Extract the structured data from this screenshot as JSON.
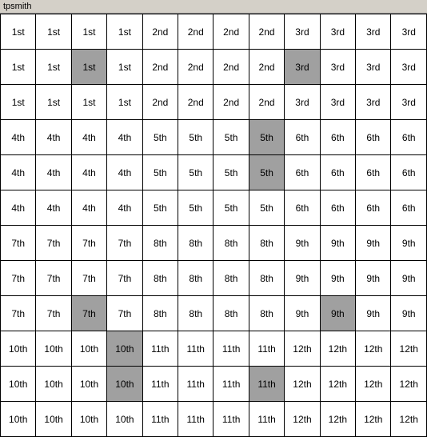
{
  "title": "tpsmith",
  "grid": {
    "rows": [
      [
        {
          "text": "1st",
          "style": "normal"
        },
        {
          "text": "1st",
          "style": "normal"
        },
        {
          "text": "1st",
          "style": "normal"
        },
        {
          "text": "1st",
          "style": "normal"
        },
        {
          "text": "2nd",
          "style": "normal"
        },
        {
          "text": "2nd",
          "style": "normal"
        },
        {
          "text": "2nd",
          "style": "normal"
        },
        {
          "text": "2nd",
          "style": "normal"
        },
        {
          "text": "3rd",
          "style": "normal"
        },
        {
          "text": "3rd",
          "style": "normal"
        },
        {
          "text": "3rd",
          "style": "normal"
        },
        {
          "text": "3rd",
          "style": "normal"
        }
      ],
      [
        {
          "text": "1st",
          "style": "normal"
        },
        {
          "text": "1st",
          "style": "normal"
        },
        {
          "text": "1st",
          "style": "highlight"
        },
        {
          "text": "1st",
          "style": "normal"
        },
        {
          "text": "2nd",
          "style": "normal"
        },
        {
          "text": "2nd",
          "style": "normal"
        },
        {
          "text": "2nd",
          "style": "normal"
        },
        {
          "text": "2nd",
          "style": "normal"
        },
        {
          "text": "3rd",
          "style": "highlight"
        },
        {
          "text": "3rd",
          "style": "normal"
        },
        {
          "text": "3rd",
          "style": "normal"
        },
        {
          "text": "3rd",
          "style": "normal"
        }
      ],
      [
        {
          "text": "1st",
          "style": "normal"
        },
        {
          "text": "1st",
          "style": "normal"
        },
        {
          "text": "1st",
          "style": "normal"
        },
        {
          "text": "1st",
          "style": "normal"
        },
        {
          "text": "2nd",
          "style": "normal"
        },
        {
          "text": "2nd",
          "style": "normal"
        },
        {
          "text": "2nd",
          "style": "normal"
        },
        {
          "text": "2nd",
          "style": "normal"
        },
        {
          "text": "3rd",
          "style": "normal"
        },
        {
          "text": "3rd",
          "style": "normal"
        },
        {
          "text": "3rd",
          "style": "normal"
        },
        {
          "text": "3rd",
          "style": "normal"
        }
      ],
      [
        {
          "text": "4th",
          "style": "normal"
        },
        {
          "text": "4th",
          "style": "normal"
        },
        {
          "text": "4th",
          "style": "normal"
        },
        {
          "text": "4th",
          "style": "normal"
        },
        {
          "text": "5th",
          "style": "normal"
        },
        {
          "text": "5th",
          "style": "normal"
        },
        {
          "text": "5th",
          "style": "normal"
        },
        {
          "text": "5th",
          "style": "highlight"
        },
        {
          "text": "6th",
          "style": "normal"
        },
        {
          "text": "6th",
          "style": "normal"
        },
        {
          "text": "6th",
          "style": "normal"
        },
        {
          "text": "6th",
          "style": "normal"
        }
      ],
      [
        {
          "text": "4th",
          "style": "normal"
        },
        {
          "text": "4th",
          "style": "normal"
        },
        {
          "text": "4th",
          "style": "normal"
        },
        {
          "text": "4th",
          "style": "normal"
        },
        {
          "text": "5th",
          "style": "normal"
        },
        {
          "text": "5th",
          "style": "normal"
        },
        {
          "text": "5th",
          "style": "normal"
        },
        {
          "text": "5th",
          "style": "highlight"
        },
        {
          "text": "6th",
          "style": "normal"
        },
        {
          "text": "6th",
          "style": "normal"
        },
        {
          "text": "6th",
          "style": "normal"
        },
        {
          "text": "6th",
          "style": "normal"
        }
      ],
      [
        {
          "text": "4th",
          "style": "normal"
        },
        {
          "text": "4th",
          "style": "normal"
        },
        {
          "text": "4th",
          "style": "normal"
        },
        {
          "text": "4th",
          "style": "normal"
        },
        {
          "text": "5th",
          "style": "normal"
        },
        {
          "text": "5th",
          "style": "normal"
        },
        {
          "text": "5th",
          "style": "normal"
        },
        {
          "text": "5th",
          "style": "normal"
        },
        {
          "text": "6th",
          "style": "normal"
        },
        {
          "text": "6th",
          "style": "normal"
        },
        {
          "text": "6th",
          "style": "normal"
        },
        {
          "text": "6th",
          "style": "normal"
        }
      ],
      [
        {
          "text": "7th",
          "style": "normal"
        },
        {
          "text": "7th",
          "style": "normal"
        },
        {
          "text": "7th",
          "style": "normal"
        },
        {
          "text": "7th",
          "style": "normal"
        },
        {
          "text": "8th",
          "style": "normal"
        },
        {
          "text": "8th",
          "style": "normal"
        },
        {
          "text": "8th",
          "style": "normal"
        },
        {
          "text": "8th",
          "style": "normal"
        },
        {
          "text": "9th",
          "style": "normal"
        },
        {
          "text": "9th",
          "style": "normal"
        },
        {
          "text": "9th",
          "style": "normal"
        },
        {
          "text": "9th",
          "style": "normal"
        }
      ],
      [
        {
          "text": "7th",
          "style": "normal"
        },
        {
          "text": "7th",
          "style": "normal"
        },
        {
          "text": "7th",
          "style": "normal"
        },
        {
          "text": "7th",
          "style": "normal"
        },
        {
          "text": "8th",
          "style": "normal"
        },
        {
          "text": "8th",
          "style": "normal"
        },
        {
          "text": "8th",
          "style": "normal"
        },
        {
          "text": "8th",
          "style": "normal"
        },
        {
          "text": "9th",
          "style": "normal"
        },
        {
          "text": "9th",
          "style": "normal"
        },
        {
          "text": "9th",
          "style": "normal"
        },
        {
          "text": "9th",
          "style": "normal"
        }
      ],
      [
        {
          "text": "7th",
          "style": "normal"
        },
        {
          "text": "7th",
          "style": "normal"
        },
        {
          "text": "7th",
          "style": "highlight"
        },
        {
          "text": "7th",
          "style": "normal"
        },
        {
          "text": "8th",
          "style": "normal"
        },
        {
          "text": "8th",
          "style": "normal"
        },
        {
          "text": "8th",
          "style": "normal"
        },
        {
          "text": "8th",
          "style": "normal"
        },
        {
          "text": "9th",
          "style": "normal"
        },
        {
          "text": "9th",
          "style": "highlight"
        },
        {
          "text": "9th",
          "style": "normal"
        },
        {
          "text": "9th",
          "style": "normal"
        }
      ],
      [
        {
          "text": "10th",
          "style": "normal"
        },
        {
          "text": "10th",
          "style": "normal"
        },
        {
          "text": "10th",
          "style": "normal"
        },
        {
          "text": "10th",
          "style": "highlight"
        },
        {
          "text": "11th",
          "style": "normal"
        },
        {
          "text": "11th",
          "style": "normal"
        },
        {
          "text": "11th",
          "style": "normal"
        },
        {
          "text": "11th",
          "style": "normal"
        },
        {
          "text": "12th",
          "style": "normal"
        },
        {
          "text": "12th",
          "style": "normal"
        },
        {
          "text": "12th",
          "style": "normal"
        },
        {
          "text": "12th",
          "style": "normal"
        }
      ],
      [
        {
          "text": "10th",
          "style": "normal"
        },
        {
          "text": "10th",
          "style": "normal"
        },
        {
          "text": "10th",
          "style": "normal"
        },
        {
          "text": "10th",
          "style": "highlight"
        },
        {
          "text": "11th",
          "style": "normal"
        },
        {
          "text": "11th",
          "style": "normal"
        },
        {
          "text": "11th",
          "style": "normal"
        },
        {
          "text": "11th",
          "style": "highlight"
        },
        {
          "text": "12th",
          "style": "normal"
        },
        {
          "text": "12th",
          "style": "normal"
        },
        {
          "text": "12th",
          "style": "normal"
        },
        {
          "text": "12th",
          "style": "normal"
        }
      ],
      [
        {
          "text": "10th",
          "style": "normal"
        },
        {
          "text": "10th",
          "style": "normal"
        },
        {
          "text": "10th",
          "style": "normal"
        },
        {
          "text": "10th",
          "style": "normal"
        },
        {
          "text": "11th",
          "style": "normal"
        },
        {
          "text": "11th",
          "style": "normal"
        },
        {
          "text": "11th",
          "style": "normal"
        },
        {
          "text": "11th",
          "style": "normal"
        },
        {
          "text": "12th",
          "style": "normal"
        },
        {
          "text": "12th",
          "style": "normal"
        },
        {
          "text": "12th",
          "style": "normal"
        },
        {
          "text": "12th",
          "style": "normal"
        }
      ]
    ]
  }
}
